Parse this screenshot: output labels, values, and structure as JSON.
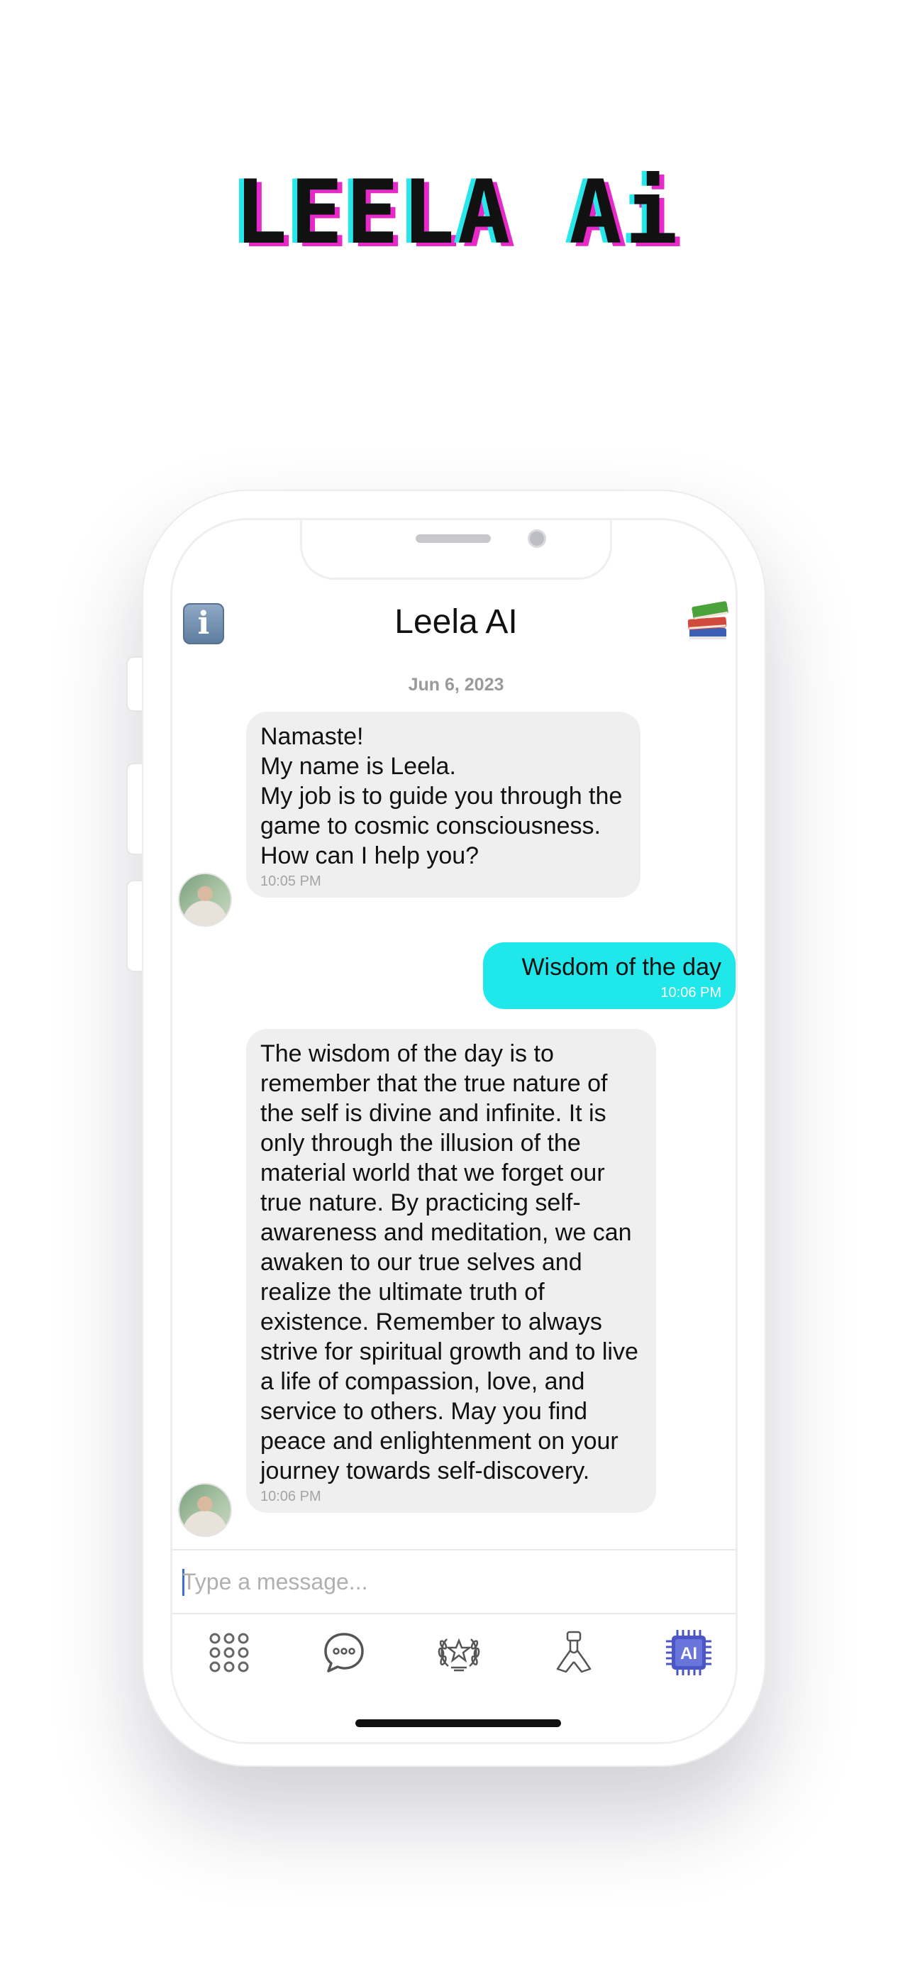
{
  "promo": {
    "title": "LEELA Ai"
  },
  "header": {
    "title": "Leela AI",
    "info_icon": "info-icon",
    "library_icon": "books-icon"
  },
  "chat": {
    "date": "Jun 6, 2023",
    "messages": [
      {
        "sender": "bot",
        "text": "Namaste!\nMy name is Leela.\nMy job is to guide you through the game to cosmic consciousness.\nHow can I help you?",
        "time": "10:05 PM"
      },
      {
        "sender": "user",
        "text": "Wisdom of the day",
        "time": "10:06 PM"
      },
      {
        "sender": "bot",
        "text": "The wisdom of the day is to remember that the true nature of the self is divine and infinite. It is only through the illusion of the material world that we forget our true nature. By practicing self-awareness and meditation, we can awaken to our true selves and realize the ultimate truth of existence. Remember to always strive for spiritual growth and to live a life of compassion, love, and service to others. May you find peace and enlightenment on your journey towards self-discovery.",
        "time": "10:06 PM"
      }
    ]
  },
  "composer": {
    "placeholder": "Type a message...",
    "value": ""
  },
  "tabbar": {
    "tabs": [
      {
        "icon": "grid-icon",
        "active": false
      },
      {
        "icon": "chat-bubble-icon",
        "active": false
      },
      {
        "icon": "laurel-star-icon",
        "active": false
      },
      {
        "icon": "praying-hands-icon",
        "active": false
      },
      {
        "icon": "ai-chip-icon",
        "active": true,
        "label": "AI"
      }
    ]
  },
  "colors": {
    "outgoing_bubble": "#20e7ea",
    "incoming_bubble": "#efefef",
    "accent_chip": "#4a56c8",
    "title_shadow_cyan": "#29e6ea",
    "title_shadow_magenta": "#e629c8"
  }
}
